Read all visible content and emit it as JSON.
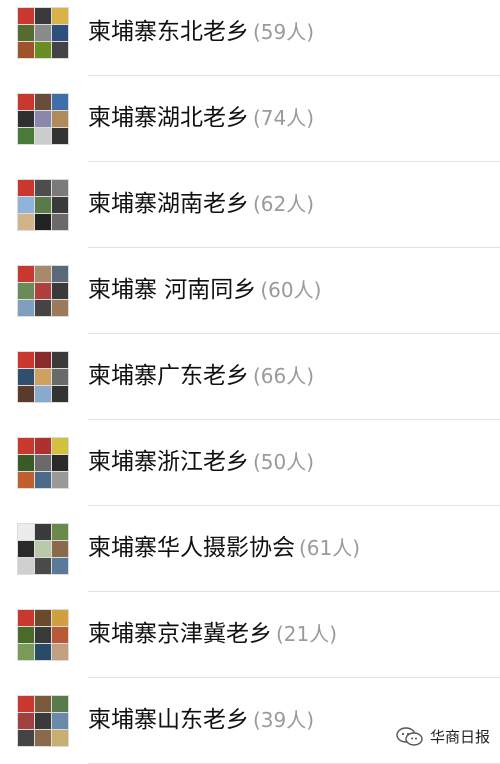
{
  "groups": [
    {
      "name": "柬埔寨东北老乡",
      "count": "(59人)"
    },
    {
      "name": "柬埔寨湖北老乡",
      "count": "(74人)"
    },
    {
      "name": "柬埔寨湖南老乡",
      "count": "(62人)"
    },
    {
      "name": "柬埔寨 河南同乡",
      "count": "(60人)"
    },
    {
      "name": "柬埔寨广东老乡",
      "count": "(66人)"
    },
    {
      "name": "柬埔寨浙江老乡",
      "count": "(50人)"
    },
    {
      "name": "柬埔寨华人摄影协会",
      "count": "(61人)"
    },
    {
      "name": "柬埔寨京津冀老乡",
      "count": "(21人)"
    },
    {
      "name": "柬埔寨山东老乡",
      "count": "(39人)"
    }
  ],
  "watermark": {
    "text": "华商日报",
    "icon": "wechat-icon"
  },
  "avatar_palettes": [
    [
      "#c8382e",
      "#3a3a3a",
      "#d9b24a",
      "#556b2f",
      "#8a8a8a",
      "#2d4f7c",
      "#a0522d",
      "#6b8e23",
      "#444"
    ],
    [
      "#c8382e",
      "#6b4c3b",
      "#3e6fa8",
      "#2f2f2f",
      "#88a",
      "#b08a5a",
      "#4a7a3a",
      "#ccc",
      "#333"
    ],
    [
      "#c8382e",
      "#4d4d4d",
      "#7a7a7a",
      "#8fb3d9",
      "#5a7a4a",
      "#3a3a3a",
      "#d2b48c",
      "#222",
      "#6a6a6a"
    ],
    [
      "#c8382e",
      "#a88a6a",
      "#5a6a7a",
      "#6a8a5a",
      "#b04040",
      "#3a3a3a",
      "#7f9fbf",
      "#444",
      "#9a7a5a"
    ],
    [
      "#c8382e",
      "#8a2a2a",
      "#3a3a3a",
      "#2f4f6f",
      "#d0a060",
      "#6a6a6a",
      "#5a3a2a",
      "#88aacc",
      "#333"
    ],
    [
      "#c8382e",
      "#b03030",
      "#d4c040",
      "#3a5a2a",
      "#6a6a6a",
      "#2a2a2a",
      "#c06030",
      "#4a6a8a",
      "#999"
    ],
    [
      "#ececec",
      "#3a3a3a",
      "#6a8a4a",
      "#2a2a2a",
      "#b9c9a9",
      "#8a6a4a",
      "#d0d0d0",
      "#4a4a4a",
      "#5a7a9a"
    ],
    [
      "#c8382e",
      "#6a4a2a",
      "#d0a040",
      "#4a6a2a",
      "#3a3a3a",
      "#b85a3a",
      "#7a9a5a",
      "#2a4a6a",
      "#c0a080"
    ],
    [
      "#c8382e",
      "#7a5a3a",
      "#5a7a4a",
      "#a04040",
      "#3a3a3a",
      "#6a8aaa",
      "#444",
      "#8a6a4a",
      "#c9b070"
    ]
  ]
}
